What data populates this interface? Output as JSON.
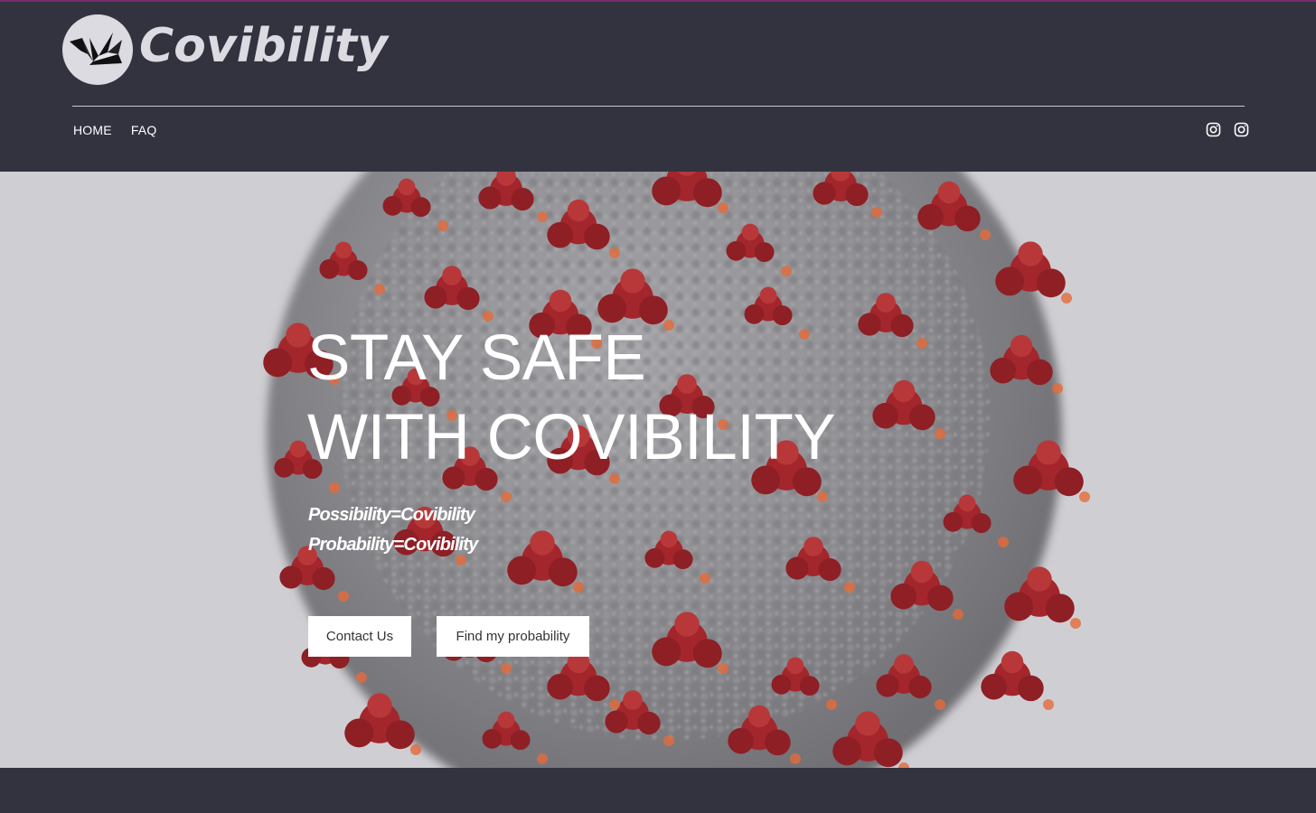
{
  "brand": {
    "name": "Covibility",
    "logo_icon": "paper-crane-icon"
  },
  "nav": {
    "items": [
      {
        "label": "HOME"
      },
      {
        "label": "FAQ"
      }
    ]
  },
  "social": {
    "icons": [
      "instagram-icon",
      "instagram-icon"
    ]
  },
  "hero": {
    "headline_line1": "STAY SAFE",
    "headline_line2": "WITH COVIBILITY",
    "tagline_line1": "Possibility=Covibility",
    "tagline_line2": "Probability=Covibility",
    "background_image": "coronavirus-illustration"
  },
  "buttons": {
    "contact_label": "Contact Us",
    "find_label": "Find my probability"
  },
  "colors": {
    "header_bg": "#33333f",
    "hero_bg": "#cfcfd3",
    "virus_red": "#a3262c",
    "virus_gray": "#8e8e92",
    "accent_line": "#7a2d6e"
  }
}
